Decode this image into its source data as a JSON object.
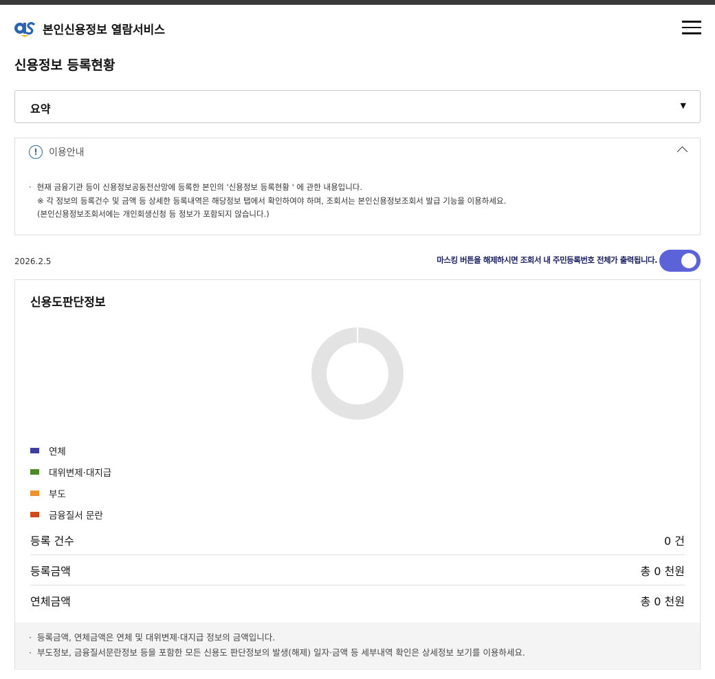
{
  "header": {
    "brand": "본인신용정보 열람서비스"
  },
  "page": {
    "title": "신용정보 등록현황"
  },
  "dropdown": {
    "selected": "요약"
  },
  "notice": {
    "heading": "이용안내",
    "lines": [
      "현재 금융기관 등이 신용정보공동전산망에 등록한 본인의 '신용정보 등록현황 ' 에 관한 내용입니다.",
      "※ 각 정보의 등록건수 및 금액 등 상세한 등록내역은 해당정보 탭에서 확인하여야 하며, 조회서는 본인신용정보조회서 발급 기능을 이용하세요.",
      "(본인신용정보조회서에는 개인회생신청 등 정보가 포함되지 않습니다.)"
    ]
  },
  "date": "2026.2.5",
  "masking": {
    "text": "마스킹 버튼을 해제하시면 조회서 내 주민등록번호 전체가 출력됩니다.",
    "enabled": true
  },
  "card": {
    "title": "신용도판단정보",
    "legend": [
      {
        "label": "연체",
        "color": "#3b3f9f"
      },
      {
        "label": "대위변제·대지급",
        "color": "#4a8a2a"
      },
      {
        "label": "부도",
        "color": "#f0922a"
      },
      {
        "label": "금융질서 문란",
        "color": "#d04a1a"
      }
    ],
    "rows": [
      {
        "label": "등록 건수",
        "value": "0 건"
      },
      {
        "label": "등록금액",
        "value": "총 0 천원"
      },
      {
        "label": "연체금액",
        "value": "총 0 천원"
      }
    ],
    "footnotes": [
      "등록금액, 연체금액은 연체 및 대위변제·대지급 정보의 금액입니다.",
      "부도정보, 금융질서문란정보 등을 포함한 모든 신용도 판단정보의 발생(해제) 일자·금액 등 세부내역 확인은 상세정보 보기를 이용하세요."
    ]
  },
  "colors": {
    "toggle": "#5c63d8",
    "donut_empty": "#e3e3e3",
    "mask_text": "#1b1f5e"
  }
}
